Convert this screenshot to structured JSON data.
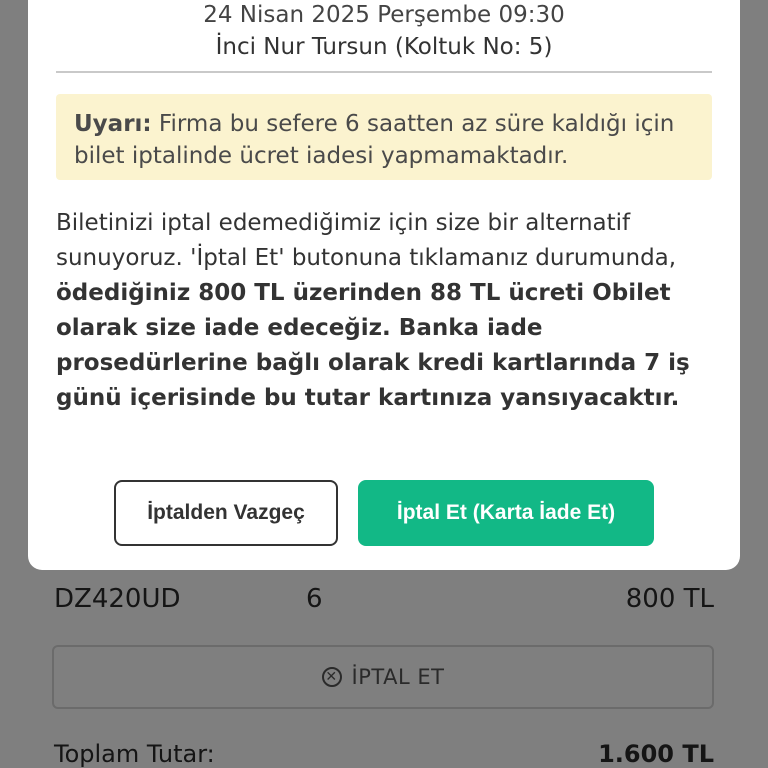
{
  "modal": {
    "trip_datetime": "24 Nisan 2025 Perşembe 09:30",
    "passenger": "İnci Nur Tursun (Koltuk No: 5)",
    "warning": {
      "label": "Uyarı:",
      "text": " Firma bu sefere 6 saatten az süre kaldığı için bilet iptalinde ücret iadesi yapmamaktadır."
    },
    "info": {
      "intro": "Biletinizi iptal edemediğimiz için size bir alternatif sunuyoruz. 'İptal Et' butonuna tıklamanız durumunda, ",
      "bold_text": "ödediğiniz 800 TL üzerinden 88 TL ücreti Obilet olarak size iade edeceğiz. Banka iade prosedürlerine bağlı olarak  kredi kartlarında 7 iş günü içerisinde bu tutar kartınıza yansıyacaktır."
    },
    "buttons": {
      "dismiss_label": "İptalden Vazgeç",
      "confirm_label": "İptal Et (Karta İade Et)"
    },
    "colors": {
      "confirm_bg": "#12b886",
      "warning_bg": "#fbf3cf"
    }
  },
  "background": {
    "ticket_row": {
      "pnr": "DZ420UD",
      "seat": "6",
      "price": "800 TL"
    },
    "cancel_button_label": "İPTAL ET",
    "total": {
      "label": "Toplam Tutar:",
      "value": "1.600 TL"
    }
  }
}
